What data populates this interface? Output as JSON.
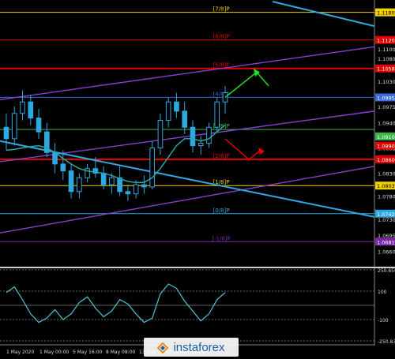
{
  "chart_data": [
    {
      "type": "candlestick",
      "symbol_pair": "EUR/USD",
      "ylim": [
        1.063,
        1.12
      ],
      "price_labels": [
        "1.1100",
        "1.1080",
        "1.1030",
        "1.0975",
        "1.0940",
        "1.0885",
        "1.0830",
        "1.0780",
        "1.0730",
        "1.0695",
        "1.0660"
      ],
      "price_tags": [
        {
          "value": "1.1180",
          "y": 1.118,
          "color": "#f2d000"
        },
        {
          "value": "1.1120",
          "y": 1.112,
          "color": "#e00000"
        },
        {
          "value": "1.1058",
          "y": 1.1058,
          "color": "#e00000"
        },
        {
          "value": "1.0995",
          "y": 1.0995,
          "color": "#3a6cd8"
        },
        {
          "value": "1.0910",
          "y": 1.091,
          "color": "#3db34a"
        },
        {
          "value": "1.0890",
          "y": 1.089,
          "color": "#e00000"
        },
        {
          "value": "1.0860",
          "y": 1.086,
          "color": "#e00000"
        },
        {
          "value": "1.0803",
          "y": 1.0803,
          "color": "#f2d000"
        },
        {
          "value": "1.0742",
          "y": 1.0742,
          "color": "#2ea8e0"
        },
        {
          "value": "1.0681",
          "y": 1.0681,
          "color": "#7a2aa8"
        }
      ],
      "murray_levels": [
        {
          "label": "[7/8]P",
          "y": 1.118,
          "color": "#f2d000"
        },
        {
          "label": "[6/8]P",
          "y": 1.112,
          "color": "#e00000"
        },
        {
          "label": "[5/8]P",
          "y": 1.1058,
          "color": "#e00000"
        },
        {
          "label": "[4/8]P",
          "y": 1.0995,
          "color": "#3a6cd8"
        },
        {
          "label": "[3/8]P",
          "y": 1.0925,
          "color": "#3db34a"
        },
        {
          "label": "[2/8]P",
          "y": 1.086,
          "color": "#e00000"
        },
        {
          "label": "[1/8]P",
          "y": 1.0803,
          "color": "#f2d000"
        },
        {
          "label": "[0/8]P",
          "y": 1.0742,
          "color": "#2ea8e0"
        },
        {
          "label": "[-1/8]P",
          "y": 1.0681,
          "color": "#7a2aa8"
        }
      ],
      "candles": [
        {
          "o": 1.093,
          "h": 1.096,
          "l": 1.088,
          "c": 1.0905
        },
        {
          "o": 1.0905,
          "h": 1.0975,
          "l": 1.089,
          "c": 1.096
        },
        {
          "o": 1.096,
          "h": 1.101,
          "l": 1.0945,
          "c": 1.0985
        },
        {
          "o": 1.0985,
          "h": 1.1,
          "l": 1.0935,
          "c": 1.095
        },
        {
          "o": 1.095,
          "h": 1.097,
          "l": 1.0905,
          "c": 1.092
        },
        {
          "o": 1.092,
          "h": 1.094,
          "l": 1.0865,
          "c": 1.0875
        },
        {
          "o": 1.0875,
          "h": 1.0895,
          "l": 1.083,
          "c": 1.085
        },
        {
          "o": 1.085,
          "h": 1.088,
          "l": 1.0815,
          "c": 1.0835
        },
        {
          "o": 1.0835,
          "h": 1.085,
          "l": 1.0775,
          "c": 1.079
        },
        {
          "o": 1.079,
          "h": 1.083,
          "l": 1.0775,
          "c": 1.082
        },
        {
          "o": 1.082,
          "h": 1.085,
          "l": 1.081,
          "c": 1.084
        },
        {
          "o": 1.084,
          "h": 1.0865,
          "l": 1.082,
          "c": 1.083
        },
        {
          "o": 1.083,
          "h": 1.0845,
          "l": 1.0795,
          "c": 1.0805
        },
        {
          "o": 1.0805,
          "h": 1.083,
          "l": 1.0785,
          "c": 1.082
        },
        {
          "o": 1.082,
          "h": 1.0845,
          "l": 1.078,
          "c": 1.079
        },
        {
          "o": 1.079,
          "h": 1.0805,
          "l": 1.077,
          "c": 1.0785
        },
        {
          "o": 1.0785,
          "h": 1.0815,
          "l": 1.0775,
          "c": 1.0805
        },
        {
          "o": 1.0805,
          "h": 1.0825,
          "l": 1.0785,
          "c": 1.08
        },
        {
          "o": 1.08,
          "h": 1.09,
          "l": 1.0795,
          "c": 1.0885
        },
        {
          "o": 1.0885,
          "h": 1.096,
          "l": 1.087,
          "c": 1.0945
        },
        {
          "o": 1.0945,
          "h": 1.0995,
          "l": 1.093,
          "c": 1.0985
        },
        {
          "o": 1.0985,
          "h": 1.1005,
          "l": 1.095,
          "c": 1.0965
        },
        {
          "o": 1.0965,
          "h": 1.0985,
          "l": 1.0915,
          "c": 1.093
        },
        {
          "o": 1.093,
          "h": 1.0945,
          "l": 1.0875,
          "c": 1.089
        },
        {
          "o": 1.089,
          "h": 1.091,
          "l": 1.087,
          "c": 1.0895
        },
        {
          "o": 1.0895,
          "h": 1.094,
          "l": 1.0885,
          "c": 1.093
        },
        {
          "o": 1.093,
          "h": 1.0995,
          "l": 1.092,
          "c": 1.0985
        },
        {
          "o": 1.0985,
          "h": 1.102,
          "l": 1.096,
          "c": 1.1005
        }
      ],
      "ma_values": [
        1.088,
        1.0882,
        1.0885,
        1.0888,
        1.089,
        1.0885,
        1.0875,
        1.0862,
        1.085,
        1.084,
        1.0835,
        1.0832,
        1.083,
        1.0825,
        1.0818,
        1.0812,
        1.081,
        1.081,
        1.082,
        1.084,
        1.0865,
        1.089,
        1.0905,
        1.0905,
        1.09,
        1.0905,
        1.092,
        1.0935
      ],
      "x_labels": [
        "1 May 2020",
        "1 May 00:00",
        "5 May 16:00",
        "8 May 08:00",
        "13 May 00:00",
        "15 May 16:00"
      ]
    },
    {
      "type": "line",
      "name": "CCI",
      "ylim": [
        -250,
        250
      ],
      "level_labels": [
        "250.6596",
        "100",
        "-100",
        "-250.834"
      ],
      "levels": [
        250,
        100,
        0,
        -100,
        -250
      ],
      "values": [
        90,
        130,
        40,
        -60,
        -120,
        -90,
        -30,
        -100,
        -60,
        20,
        60,
        -20,
        -80,
        -40,
        40,
        10,
        -60,
        -120,
        -90,
        80,
        150,
        120,
        30,
        -40,
        -110,
        -60,
        40,
        90
      ]
    }
  ],
  "logo": {
    "text": "instaforex"
  }
}
